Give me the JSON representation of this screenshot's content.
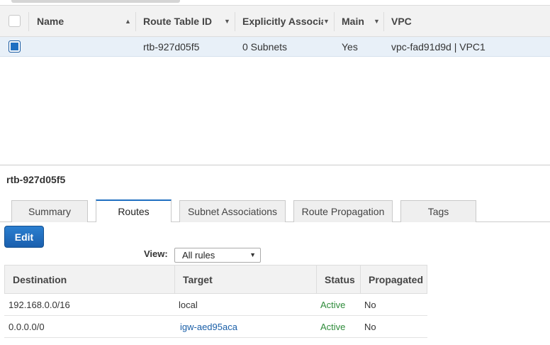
{
  "grid": {
    "columns": {
      "name": "Name",
      "route_table_id": "Route Table ID",
      "explicitly_associated": "Explicitly Associat",
      "main": "Main",
      "vpc": "VPC"
    },
    "rows": [
      {
        "selected": true,
        "name": "",
        "route_table_id": "rtb-927d05f5",
        "explicitly_associated": "0 Subnets",
        "main": "Yes",
        "vpc": "vpc-fad91d9d | VPC1"
      }
    ]
  },
  "detail": {
    "title": "rtb-927d05f5",
    "tabs": [
      "Summary",
      "Routes",
      "Subnet Associations",
      "Route Propagation",
      "Tags"
    ],
    "active_tab": "Routes",
    "edit_label": "Edit",
    "view_label": "View:",
    "view_value": "All rules",
    "routes": {
      "columns": {
        "destination": "Destination",
        "target": "Target",
        "status": "Status",
        "propagated": "Propagated"
      },
      "rows": [
        {
          "destination": "192.168.0.0/16",
          "target": "local",
          "status": "Active",
          "propagated": "No"
        },
        {
          "destination": "0.0.0.0/0",
          "target": "igw-aed95aca",
          "status": "Active",
          "propagated": "No"
        }
      ]
    }
  },
  "colors": {
    "accent": "#1f6fc1",
    "selected_row": "#e8f0f8",
    "status_active": "#2e8b3a",
    "link": "#1a5fa8"
  }
}
